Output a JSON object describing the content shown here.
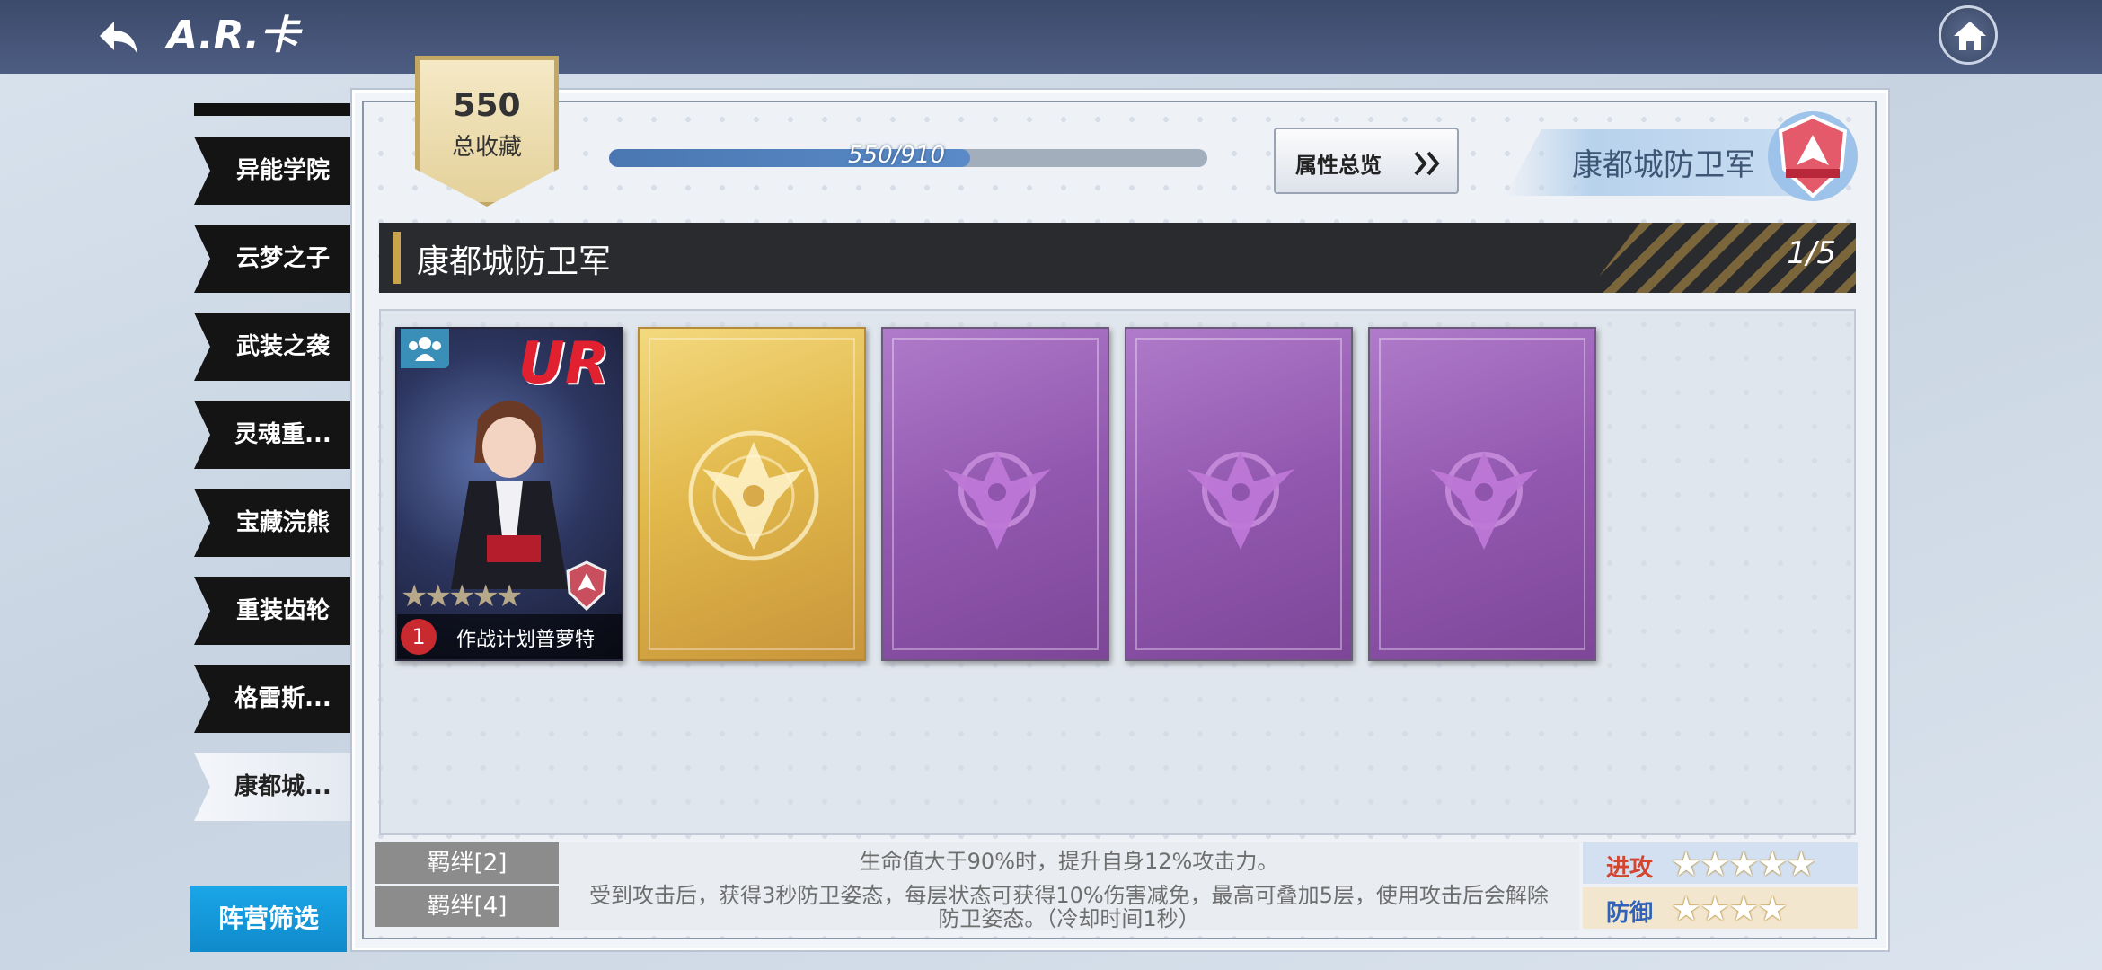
{
  "header": {
    "title": "A.R.卡"
  },
  "sidebar": {
    "items": [
      {
        "label": "异能学院"
      },
      {
        "label": "云梦之子"
      },
      {
        "label": "武装之袭"
      },
      {
        "label": "灵魂重..."
      },
      {
        "label": "宝藏浣熊"
      },
      {
        "label": "重装齿轮"
      },
      {
        "label": "格雷斯..."
      },
      {
        "label": "康都城..."
      }
    ],
    "active_index": 7,
    "filter_label": "阵营筛选"
  },
  "collection": {
    "count": "550",
    "label": "总收藏",
    "progress_text": "550/910",
    "progress_fraction": 0.604
  },
  "attribute_button_label": "属性总览",
  "faction": {
    "name": "康都城防卫军"
  },
  "section": {
    "title": "康都城防卫军",
    "page": "1/5"
  },
  "cards": [
    {
      "state": "owned",
      "rarity_label": "UR",
      "level": "1",
      "name": "作战计划普萝特",
      "stars": "★★★★★"
    },
    {
      "state": "locked-gold"
    },
    {
      "state": "locked-purple"
    },
    {
      "state": "locked-purple"
    },
    {
      "state": "locked-purple"
    }
  ],
  "bonds": [
    {
      "label": "羁绊[2]",
      "text": "生命值大于90%时，提升自身12%攻击力。"
    },
    {
      "label": "羁绊[4]",
      "text_line1": "受到攻击后，获得3秒防卫姿态，每层状态可获得10%伤害减免，最高可叠加5层，使用攻击后会解除",
      "text_line2": "防卫姿态。（冷却时间1秒）"
    }
  ],
  "stats": {
    "attack": {
      "label": "进攻",
      "stars": "★★★★★",
      "rating": 5
    },
    "defense": {
      "label": "防御",
      "stars": "★★★★",
      "rating": 4
    }
  },
  "colors": {
    "attack_label": "#d2452f",
    "defense_label": "#2f62b8",
    "filter_button": "#1aa6e8",
    "accent_gold": "#c9a44b"
  }
}
